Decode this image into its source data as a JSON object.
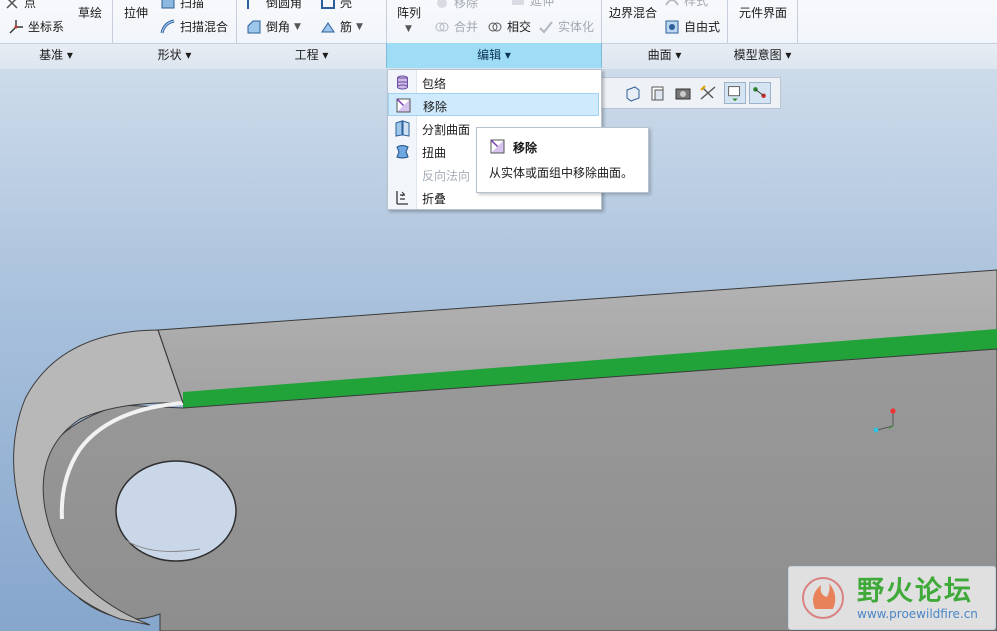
{
  "ribbon": {
    "top_row": [
      {
        "label": "点",
        "disabled": false
      },
      {
        "label": "扫描",
        "disabled": false
      },
      {
        "label": "倒圆角",
        "disabled": false
      },
      {
        "label": "壳",
        "disabled": false
      },
      {
        "label": "移除",
        "disabled": true
      },
      {
        "label": "延伸",
        "disabled": true
      },
      {
        "label": "样式",
        "disabled": true
      }
    ],
    "buttons": {
      "coord_system": "坐标系",
      "sketch": "草绘",
      "extrude": "拉伸",
      "sweep_blend": "扫描混合",
      "chamfer": "倒角",
      "rib": "筋",
      "pattern": "阵列",
      "merge": "合并",
      "intersect": "相交",
      "solidify": "实体化",
      "boundary_blend": "边界混合",
      "freestyle": "自由式",
      "component_interface": "元件界面"
    },
    "groups": [
      {
        "label": "基准 ▾"
      },
      {
        "label": "形状 ▾"
      },
      {
        "label": "工程 ▾"
      },
      {
        "label": "编辑 ▾",
        "active": true
      },
      {
        "label": "曲面 ▾"
      },
      {
        "label": "模型意图 ▾"
      }
    ]
  },
  "edit_menu": {
    "items": [
      {
        "label": "包络",
        "icon": "wrap-icon",
        "state": "normal"
      },
      {
        "label": "移除",
        "icon": "remove-surface-icon",
        "state": "hover"
      },
      {
        "label": "分割曲面",
        "icon": "split-surface-icon",
        "state": "normal"
      },
      {
        "label": "扭曲",
        "icon": "warp-icon",
        "state": "normal"
      },
      {
        "label": "反向法向",
        "icon": "",
        "state": "disabled"
      },
      {
        "label": "折叠",
        "icon": "fold-icon",
        "state": "normal"
      }
    ]
  },
  "tooltip": {
    "title": "移除",
    "description": "从实体或面组中移除曲面。"
  },
  "watermark": {
    "title": "野火论坛",
    "url": "www.proewildfire.cn"
  },
  "colors": {
    "accent": "#9fdcf5",
    "highlight_edge": "#22a33a",
    "model_gray": "#9c9c9c"
  }
}
